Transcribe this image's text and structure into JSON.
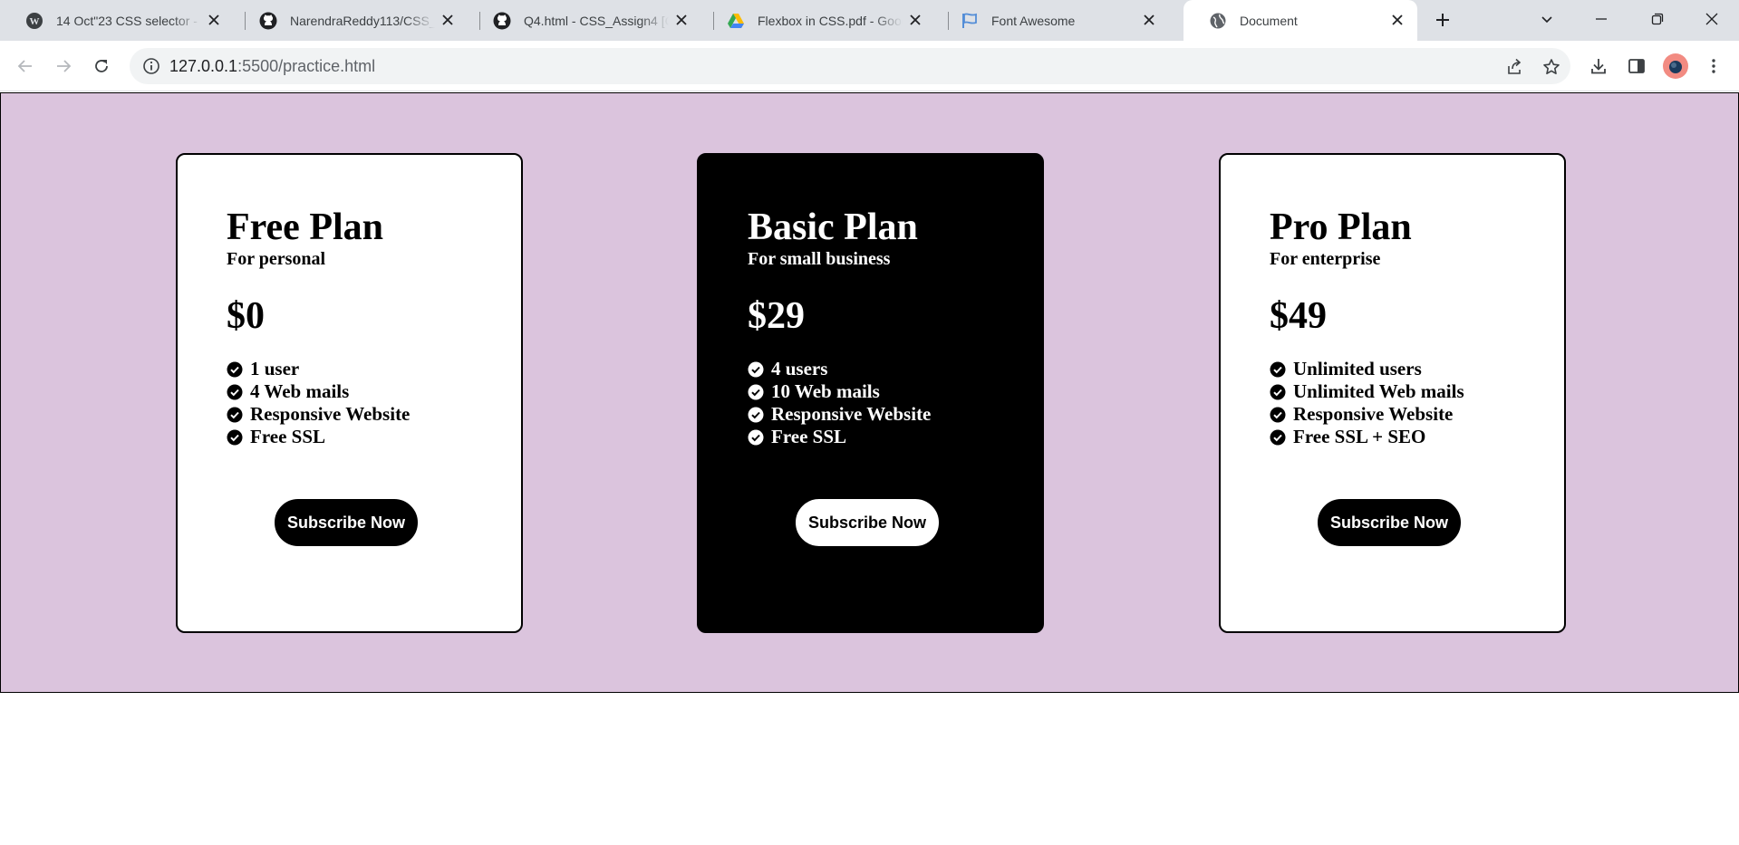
{
  "browser": {
    "tabs": [
      {
        "title": "14 Oct\"23 CSS selector - Full",
        "icon": "wordpress-icon"
      },
      {
        "title": "NarendraReddy113/CSS_Assi",
        "icon": "github-icon"
      },
      {
        "title": "Q4.html - CSS_Assign4 [Code",
        "icon": "github-icon"
      },
      {
        "title": "Flexbox in CSS.pdf - Google",
        "icon": "google-drive-icon"
      },
      {
        "title": "Font Awesome",
        "icon": "font-awesome-flag-icon"
      },
      {
        "title": "Document",
        "icon": "globe-icon",
        "active": true
      }
    ],
    "url_host": "127.0.0.1",
    "url_rest": ":5500/practice.html"
  },
  "page": {
    "background": "#dbc4dd",
    "plans": [
      {
        "name": "Free Plan",
        "subtitle": "For personal",
        "price": "$0",
        "features": [
          "1 user",
          "4 Web mails",
          "Responsive Website",
          "Free SSL"
        ],
        "button": "Subscribe Now",
        "theme": "light"
      },
      {
        "name": "Basic Plan",
        "subtitle": "For small business",
        "price": "$29",
        "features": [
          "4 users",
          "10 Web mails",
          "Responsive Website",
          "Free SSL"
        ],
        "button": "Subscribe Now",
        "theme": "dark"
      },
      {
        "name": "Pro Plan",
        "subtitle": "For enterprise",
        "price": "$49",
        "features": [
          "Unlimited users",
          "Unlimited Web mails",
          "Responsive Website",
          "Free SSL + SEO"
        ],
        "button": "Subscribe Now",
        "theme": "light"
      }
    ]
  }
}
